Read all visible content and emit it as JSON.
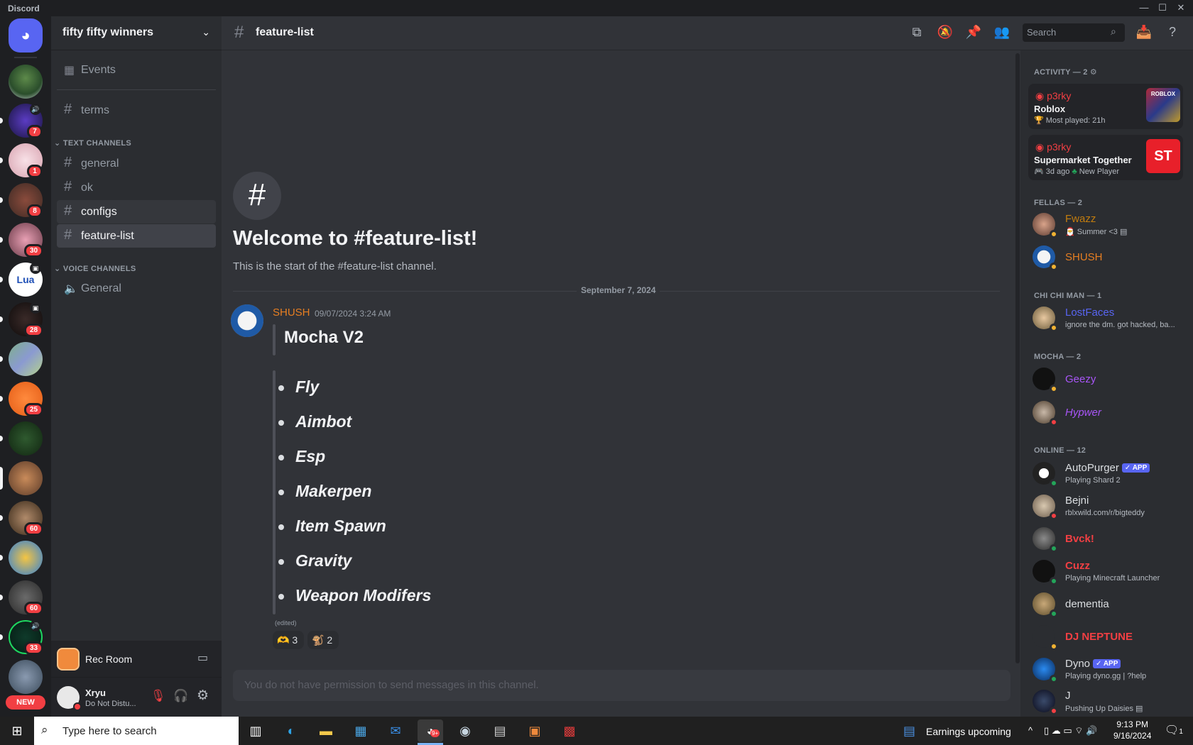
{
  "window": {
    "title": "Discord"
  },
  "guild": {
    "name": "fifty fifty winners",
    "events_label": "Events"
  },
  "channels": {
    "terms": "terms",
    "text_category": "TEXT CHANNELS",
    "text": [
      "general",
      "ok",
      "configs",
      "feature-list"
    ],
    "voice_category": "VOICE CHANNELS",
    "voice": [
      "General"
    ]
  },
  "server_badges": [
    "7",
    "1",
    "8",
    "30",
    "28",
    "25",
    "60",
    "60",
    "33"
  ],
  "server_lua_label": "Lua",
  "new_label": "NEW",
  "activity_panel": {
    "name": "Rec Room"
  },
  "user": {
    "name": "Xryu",
    "status": "Do Not Distu..."
  },
  "header": {
    "channel": "feature-list",
    "search_placeholder": "Search"
  },
  "welcome": {
    "title": "Welcome to #feature-list!",
    "subtitle": "This is the start of the #feature-list channel."
  },
  "divider_date": "September 7, 2024",
  "message": {
    "author": "SHUSH",
    "timestamp": "09/07/2024 3:24 AM",
    "heading": "Mocha V2",
    "features": [
      "Fly",
      "Aimbot",
      "Esp",
      "Makerpen",
      "Item Spawn",
      "Gravity",
      "Weapon Modifers"
    ],
    "edited": "(edited)",
    "reactions": [
      {
        "emoji": "🫶",
        "count": "3"
      },
      {
        "emoji": "🐒",
        "count": "2"
      }
    ]
  },
  "composer_placeholder": "You do not have permission to send messages in this channel.",
  "members": {
    "activity_header": "ACTIVITY — 2",
    "activities": [
      {
        "user": "p3rky",
        "game": "Roblox",
        "detail": "Most played: 21h",
        "thumb": "ROBLOX"
      },
      {
        "user": "p3rky",
        "game": "Supermarket Together",
        "detail": "3d ago",
        "tag": "New Player",
        "thumb": "ST"
      }
    ],
    "groups": [
      {
        "title": "FELLAS — 2",
        "items": [
          {
            "name": "Fwazz",
            "sub": "Summer <3",
            "color": "#c27c0e"
          },
          {
            "name": "SHUSH",
            "sub": "",
            "color": "#e67e22"
          }
        ]
      },
      {
        "title": "CHI CHI MAN — 1",
        "items": [
          {
            "name": "LostFaces",
            "sub": "ignore the dm. got hacked, ba...",
            "color": "#5865f2"
          }
        ]
      },
      {
        "title": "MOCHA — 2",
        "items": [
          {
            "name": "Geezy",
            "sub": "",
            "color": "#a855f7"
          },
          {
            "name": "Hypwer",
            "sub": "",
            "color": "#a855f7"
          }
        ]
      },
      {
        "title": "ONLINE — 12",
        "items": [
          {
            "name": "AutoPurger",
            "sub": "Playing Shard 2",
            "color": "#dbdee1",
            "app": "APP"
          },
          {
            "name": "Bejni",
            "sub": "rblxwild.com/r/bigteddy",
            "color": "#dbdee1"
          },
          {
            "name": "Bvck!",
            "sub": "",
            "color": "#f23f43"
          },
          {
            "name": "Cuzz",
            "sub": "Playing Minecraft Launcher",
            "color": "#f23f43"
          },
          {
            "name": "dementia",
            "sub": "",
            "color": "#dbdee1"
          },
          {
            "name": "DJ NEPTUNE",
            "sub": "",
            "color": "#f23f43"
          },
          {
            "name": "Dyno",
            "sub": "Playing dyno.gg | ?help",
            "color": "#dbdee1",
            "app": "APP"
          },
          {
            "name": "J",
            "sub": "Pushing Up Daisies",
            "color": "#dbdee1"
          }
        ]
      }
    ]
  },
  "taskbar": {
    "search_placeholder": "Type here to search",
    "news": "Earnings upcoming",
    "time": "9:13 PM",
    "date": "9/16/2024",
    "notif_count": "1",
    "discord_badge": "9+"
  }
}
